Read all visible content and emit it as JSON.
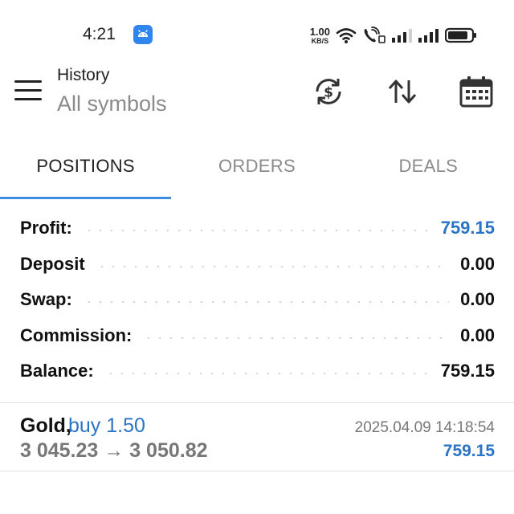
{
  "status_bar": {
    "time": "4:21",
    "app_icon": "android-icon",
    "net_speed_value": "1.00",
    "net_speed_unit": "KB/S",
    "icons": [
      "wifi-icon",
      "volte-call-icon",
      "signal-icon",
      "signal-icon",
      "battery-icon"
    ]
  },
  "header": {
    "title": "History",
    "subtitle": "All symbols",
    "icons": [
      "menu-icon",
      "currency-exchange-icon",
      "sort-icon",
      "calendar-icon"
    ]
  },
  "tabs": [
    {
      "label": "POSITIONS",
      "active": true
    },
    {
      "label": "ORDERS",
      "active": false
    },
    {
      "label": "DEALS",
      "active": false
    }
  ],
  "summary": {
    "profit_label": "Profit:",
    "profit_value": "759.15",
    "deposit_label": "Deposit",
    "deposit_value": "0.00",
    "swap_label": "Swap:",
    "swap_value": "0.00",
    "commission_label": "Commission:",
    "commission_value": "0.00",
    "balance_label": "Balance:",
    "balance_value": "759.15"
  },
  "deals": [
    {
      "symbol": "Gold,",
      "side": "buy 1.50",
      "prices": "3 045.23 → 3 050.82",
      "time": "2025.04.09 14:18:54",
      "profit": "759.15"
    }
  ],
  "colors": {
    "accent": "#2a74c8",
    "tab_indicator": "#3d8ee0",
    "muted": "#8a8a8a",
    "app_badge": "#2f86ef"
  }
}
